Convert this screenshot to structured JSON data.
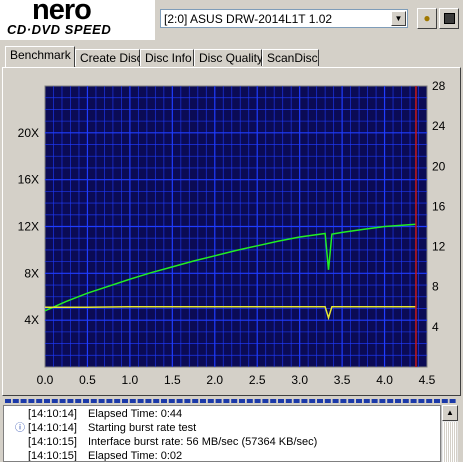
{
  "app": {
    "logo_main": "nero",
    "logo_sub": "CD·DVD SPEED"
  },
  "toolbar": {
    "drive_value": "[2:0]  ASUS DRW-2014L1T 1.02",
    "btn1_icon": "drive-refresh-icon",
    "btn2_icon": "save-disk-icon"
  },
  "tabs": [
    {
      "label": "Benchmark",
      "active": true
    },
    {
      "label": "Create Disc",
      "active": false
    },
    {
      "label": "Disc Info",
      "active": false
    },
    {
      "label": "Disc Quality",
      "active": false
    },
    {
      "label": "ScanDisc",
      "active": false
    }
  ],
  "chart_data": {
    "type": "line",
    "background": "#0b0b55",
    "grid_color": "#1f3cff",
    "x_ticks": [
      "0.0",
      "0.5",
      "1.0",
      "1.5",
      "2.0",
      "2.5",
      "3.0",
      "3.5",
      "4.0",
      "4.5"
    ],
    "xlim": [
      0,
      4.5
    ],
    "y_left_ticks": [
      "4X",
      "8X",
      "12X",
      "16X",
      "20X"
    ],
    "y_left_lim": [
      0,
      24
    ],
    "y_right_ticks": [
      "4",
      "8",
      "12",
      "16",
      "20",
      "24",
      "28"
    ],
    "y_right_lim": [
      0,
      28
    ],
    "disc_end_x": 4.37,
    "series": [
      {
        "color": "#22ee22",
        "axis": "left",
        "points": [
          [
            0,
            4.8
          ],
          [
            0.25,
            5.6
          ],
          [
            0.5,
            6.3
          ],
          [
            0.75,
            6.9
          ],
          [
            1.0,
            7.5
          ],
          [
            1.25,
            8.05
          ],
          [
            1.5,
            8.55
          ],
          [
            1.75,
            9.05
          ],
          [
            2.0,
            9.5
          ],
          [
            2.25,
            9.95
          ],
          [
            2.5,
            10.35
          ],
          [
            2.75,
            10.75
          ],
          [
            3.0,
            11.1
          ],
          [
            3.3,
            11.4
          ],
          [
            3.34,
            8.3
          ],
          [
            3.38,
            11.35
          ],
          [
            3.5,
            11.5
          ],
          [
            3.75,
            11.75
          ],
          [
            4.0,
            12.0
          ],
          [
            4.37,
            12.2
          ]
        ]
      },
      {
        "color": "#e8e832",
        "axis": "left",
        "points": [
          [
            0,
            5.1
          ],
          [
            0.5,
            5.1
          ],
          [
            1.0,
            5.15
          ],
          [
            1.5,
            5.15
          ],
          [
            2.0,
            5.15
          ],
          [
            2.5,
            5.15
          ],
          [
            3.0,
            5.15
          ],
          [
            3.3,
            5.15
          ],
          [
            3.34,
            4.2
          ],
          [
            3.38,
            5.15
          ],
          [
            3.5,
            5.15
          ],
          [
            4.0,
            5.15
          ],
          [
            4.37,
            5.15
          ]
        ]
      }
    ]
  },
  "log": {
    "lines": [
      {
        "time": "[14:10:14]",
        "msg": "Elapsed Time:  0:44",
        "icon": ""
      },
      {
        "time": "[14:10:14]",
        "msg": "Starting burst rate test",
        "icon": "info-icon"
      },
      {
        "time": "[14:10:15]",
        "msg": "Interface burst rate: 56 MB/sec (57364 KB/sec)",
        "icon": ""
      },
      {
        "time": "[14:10:15]",
        "msg": "Elapsed Time:  0:02",
        "icon": ""
      }
    ]
  }
}
